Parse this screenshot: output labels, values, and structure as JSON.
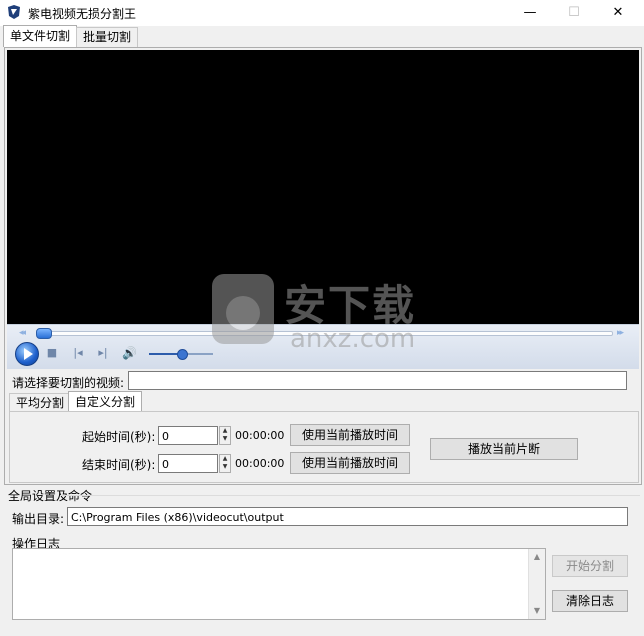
{
  "window": {
    "title": "紫电视频无损分割王",
    "min": "—",
    "max": "☐",
    "close": "✕"
  },
  "tabs": [
    "单文件切割",
    "批量切割"
  ],
  "player": {
    "rewind": "◂◂",
    "forward": "▸▸",
    "stop": "■",
    "prev": "|◂",
    "next": "▸|",
    "volume": "🔊"
  },
  "file_select": {
    "label": "请选择要切割的视频:",
    "value": ""
  },
  "subtabs": [
    "平均分割",
    "自定义分割"
  ],
  "custom": {
    "start_label": "起始时间(秒):",
    "start_value": "0",
    "start_time": "00:00:00",
    "end_label": "结束时间(秒):",
    "end_value": "0",
    "end_time": "00:00:00",
    "use_current_label": "使用当前播放时间",
    "play_segment_label": "播放当前片断"
  },
  "global": {
    "title": "全局设置及命令",
    "output_label": "输出目录:",
    "output_value": "C:\\Program Files (x86)\\videocut\\output",
    "log_label": "操作日志",
    "start_split_label": "开始分割",
    "clear_log_label": "清除日志"
  },
  "watermark": {
    "text": "安下载",
    "sub": "anxz.com"
  }
}
